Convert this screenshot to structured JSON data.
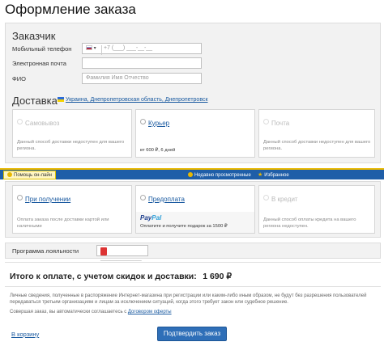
{
  "page_title": "Оформление заказа",
  "customer": {
    "heading": "Заказчик",
    "phone_label": "Мобильный телефон",
    "phone_code": "▾",
    "phone_placeholder": "+7 (___) ___-__-__",
    "email_label": "Электронная почта",
    "name_label": "ФИО",
    "name_placeholder": "Фамилия Имя Отчество"
  },
  "delivery": {
    "heading": "Доставка",
    "region_link": "Украина, Днепропетровская область, Днепропетровск",
    "options": [
      {
        "title": "Самовывоз",
        "desc": "Данный способ доставки недоступен для вашего региона.",
        "price": ""
      },
      {
        "title": "Курьер",
        "desc": "",
        "price": "вт 600 ₽, 6 дней"
      },
      {
        "title": "Почта",
        "desc": "Данный способ доставки недоступен для вашего региона.",
        "price": ""
      }
    ]
  },
  "bottom_bar": {
    "help": "Помощь он-лайн",
    "recent": "Недавно просмотренные",
    "favorites": "Избранное"
  },
  "payment": {
    "options": [
      {
        "title": "При получении",
        "desc": "Оплата заказа после доставки картой или наличными"
      },
      {
        "title": "Предоплата",
        "desc": "Оплатите и получите подарок за 1500 ₽",
        "logo_main": "Pay",
        "logo_accent": "Pal"
      },
      {
        "title": "В кредит",
        "desc": "Данный способ оплаты кредита на вашего региона недоступен."
      }
    ]
  },
  "loyalty": {
    "label": "Программа лояльности",
    "placeholder": "_____________"
  },
  "total": {
    "label": "Итого к оплате, с учетом скидок и доставки:",
    "amount": "1 690 ₽"
  },
  "notes": {
    "text": "Личные сведения, полученные в распоряжение Интернет-магазина при регистрации или каким-либо иным образом, не будут без разрешения пользователей передаваться третьим организациям и лицам за исключением ситуаций, когда этого требует закон или судебное решение.",
    "agree_prefix": "Совершая заказ, вы автоматически соглашаетесь с",
    "agree_link": "Договором оферты"
  },
  "actions": {
    "back": "В корзину",
    "confirm": "Подтвердить заказ"
  },
  "colors": {
    "accent": "#1f5ea8",
    "link": "#1a5aa0",
    "highlight": "#e9b800"
  }
}
